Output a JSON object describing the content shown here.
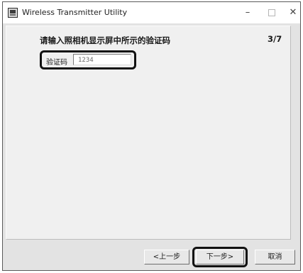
{
  "window": {
    "title": "Wireless Transmitter Utility",
    "controls": {
      "minimize": "–",
      "close": "✕"
    }
  },
  "main": {
    "heading": "请输入照相机显示屏中所示的验证码",
    "step_indicator": "3/7",
    "code_field": {
      "label": "验证码",
      "value": "1234"
    }
  },
  "buttons": {
    "prev_label": "<上一步",
    "next_label": "下一步>",
    "cancel_label": "取消"
  },
  "colors": {
    "window_background": "#e3e3e3",
    "panel_background": "#f0f0f0",
    "highlight_outline": "#111111"
  }
}
